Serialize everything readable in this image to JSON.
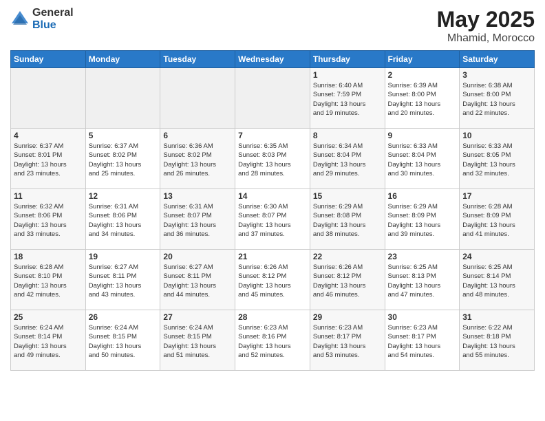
{
  "logo": {
    "general": "General",
    "blue": "Blue"
  },
  "title": "May 2025",
  "location": "Mhamid, Morocco",
  "days_of_week": [
    "Sunday",
    "Monday",
    "Tuesday",
    "Wednesday",
    "Thursday",
    "Friday",
    "Saturday"
  ],
  "weeks": [
    [
      {
        "num": "",
        "info": ""
      },
      {
        "num": "",
        "info": ""
      },
      {
        "num": "",
        "info": ""
      },
      {
        "num": "",
        "info": ""
      },
      {
        "num": "1",
        "info": "Sunrise: 6:40 AM\nSunset: 7:59 PM\nDaylight: 13 hours\nand 19 minutes."
      },
      {
        "num": "2",
        "info": "Sunrise: 6:39 AM\nSunset: 8:00 PM\nDaylight: 13 hours\nand 20 minutes."
      },
      {
        "num": "3",
        "info": "Sunrise: 6:38 AM\nSunset: 8:00 PM\nDaylight: 13 hours\nand 22 minutes."
      }
    ],
    [
      {
        "num": "4",
        "info": "Sunrise: 6:37 AM\nSunset: 8:01 PM\nDaylight: 13 hours\nand 23 minutes."
      },
      {
        "num": "5",
        "info": "Sunrise: 6:37 AM\nSunset: 8:02 PM\nDaylight: 13 hours\nand 25 minutes."
      },
      {
        "num": "6",
        "info": "Sunrise: 6:36 AM\nSunset: 8:02 PM\nDaylight: 13 hours\nand 26 minutes."
      },
      {
        "num": "7",
        "info": "Sunrise: 6:35 AM\nSunset: 8:03 PM\nDaylight: 13 hours\nand 28 minutes."
      },
      {
        "num": "8",
        "info": "Sunrise: 6:34 AM\nSunset: 8:04 PM\nDaylight: 13 hours\nand 29 minutes."
      },
      {
        "num": "9",
        "info": "Sunrise: 6:33 AM\nSunset: 8:04 PM\nDaylight: 13 hours\nand 30 minutes."
      },
      {
        "num": "10",
        "info": "Sunrise: 6:33 AM\nSunset: 8:05 PM\nDaylight: 13 hours\nand 32 minutes."
      }
    ],
    [
      {
        "num": "11",
        "info": "Sunrise: 6:32 AM\nSunset: 8:06 PM\nDaylight: 13 hours\nand 33 minutes."
      },
      {
        "num": "12",
        "info": "Sunrise: 6:31 AM\nSunset: 8:06 PM\nDaylight: 13 hours\nand 34 minutes."
      },
      {
        "num": "13",
        "info": "Sunrise: 6:31 AM\nSunset: 8:07 PM\nDaylight: 13 hours\nand 36 minutes."
      },
      {
        "num": "14",
        "info": "Sunrise: 6:30 AM\nSunset: 8:07 PM\nDaylight: 13 hours\nand 37 minutes."
      },
      {
        "num": "15",
        "info": "Sunrise: 6:29 AM\nSunset: 8:08 PM\nDaylight: 13 hours\nand 38 minutes."
      },
      {
        "num": "16",
        "info": "Sunrise: 6:29 AM\nSunset: 8:09 PM\nDaylight: 13 hours\nand 39 minutes."
      },
      {
        "num": "17",
        "info": "Sunrise: 6:28 AM\nSunset: 8:09 PM\nDaylight: 13 hours\nand 41 minutes."
      }
    ],
    [
      {
        "num": "18",
        "info": "Sunrise: 6:28 AM\nSunset: 8:10 PM\nDaylight: 13 hours\nand 42 minutes."
      },
      {
        "num": "19",
        "info": "Sunrise: 6:27 AM\nSunset: 8:11 PM\nDaylight: 13 hours\nand 43 minutes."
      },
      {
        "num": "20",
        "info": "Sunrise: 6:27 AM\nSunset: 8:11 PM\nDaylight: 13 hours\nand 44 minutes."
      },
      {
        "num": "21",
        "info": "Sunrise: 6:26 AM\nSunset: 8:12 PM\nDaylight: 13 hours\nand 45 minutes."
      },
      {
        "num": "22",
        "info": "Sunrise: 6:26 AM\nSunset: 8:12 PM\nDaylight: 13 hours\nand 46 minutes."
      },
      {
        "num": "23",
        "info": "Sunrise: 6:25 AM\nSunset: 8:13 PM\nDaylight: 13 hours\nand 47 minutes."
      },
      {
        "num": "24",
        "info": "Sunrise: 6:25 AM\nSunset: 8:14 PM\nDaylight: 13 hours\nand 48 minutes."
      }
    ],
    [
      {
        "num": "25",
        "info": "Sunrise: 6:24 AM\nSunset: 8:14 PM\nDaylight: 13 hours\nand 49 minutes."
      },
      {
        "num": "26",
        "info": "Sunrise: 6:24 AM\nSunset: 8:15 PM\nDaylight: 13 hours\nand 50 minutes."
      },
      {
        "num": "27",
        "info": "Sunrise: 6:24 AM\nSunset: 8:15 PM\nDaylight: 13 hours\nand 51 minutes."
      },
      {
        "num": "28",
        "info": "Sunrise: 6:23 AM\nSunset: 8:16 PM\nDaylight: 13 hours\nand 52 minutes."
      },
      {
        "num": "29",
        "info": "Sunrise: 6:23 AM\nSunset: 8:17 PM\nDaylight: 13 hours\nand 53 minutes."
      },
      {
        "num": "30",
        "info": "Sunrise: 6:23 AM\nSunset: 8:17 PM\nDaylight: 13 hours\nand 54 minutes."
      },
      {
        "num": "31",
        "info": "Sunrise: 6:22 AM\nSunset: 8:18 PM\nDaylight: 13 hours\nand 55 minutes."
      }
    ]
  ]
}
